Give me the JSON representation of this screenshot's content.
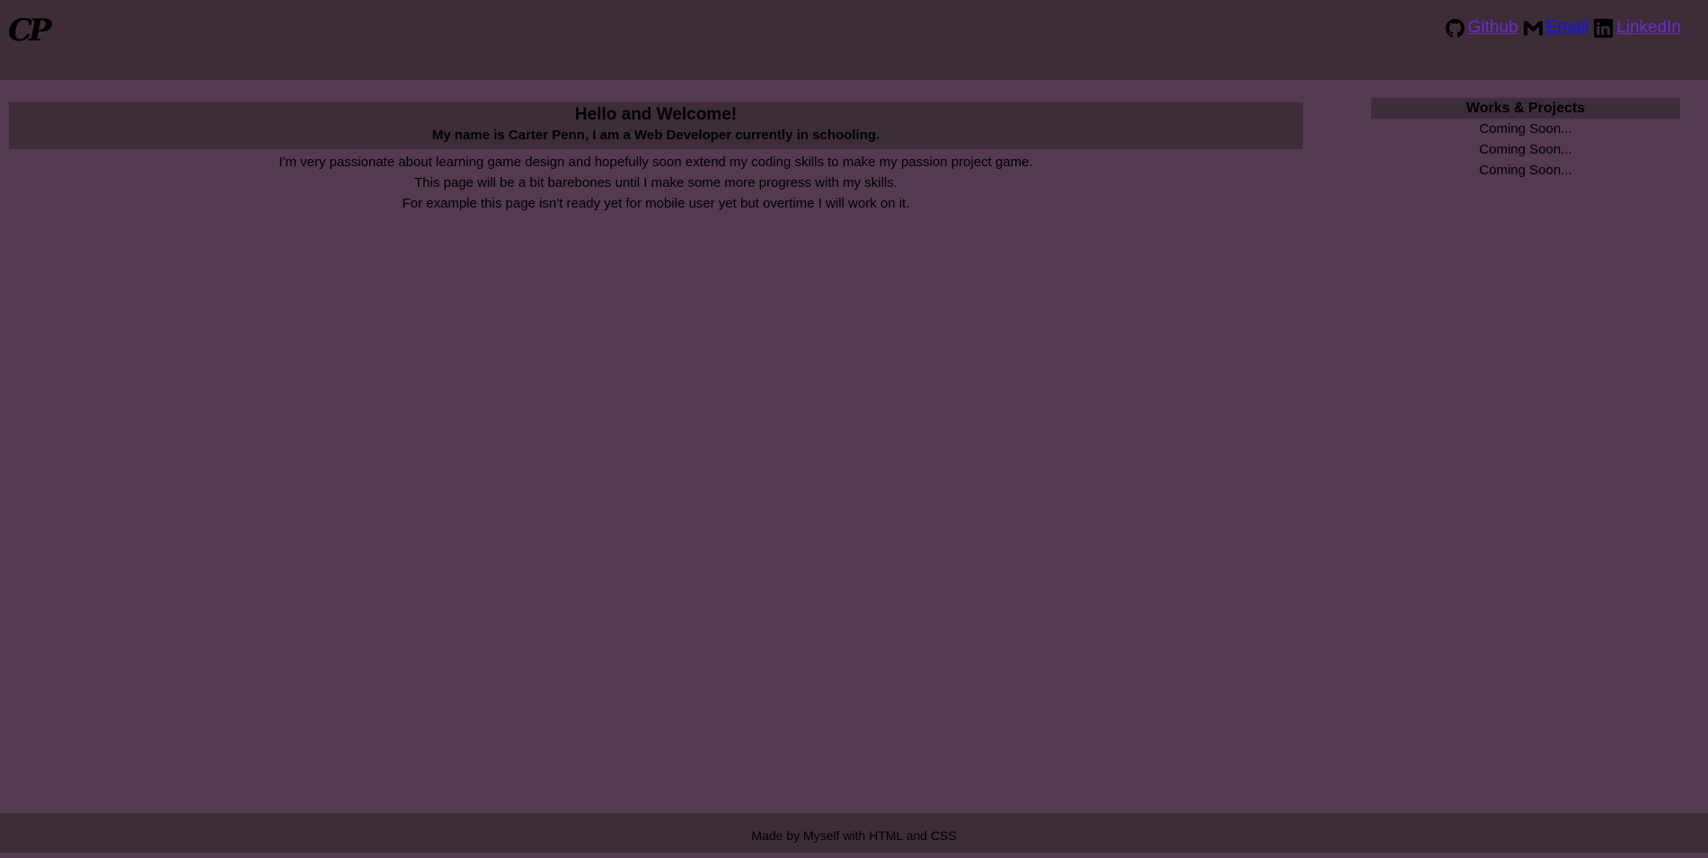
{
  "header": {
    "logo": "CP",
    "links": [
      {
        "icon": "github-icon",
        "label": " Github ",
        "state": "visited"
      },
      {
        "icon": "gmail-icon",
        "label": " Email ",
        "state": "fresh"
      },
      {
        "icon": "linkedin-icon",
        "label": " LinkedIn",
        "state": "visited"
      }
    ]
  },
  "main": {
    "title": "Hello and Welcome!",
    "subtitle": "My name is Carter Penn, I am a Web Developer currently in schooling.",
    "paragraphs": [
      "I'm very passionate about learning game design and hopefully soon extend my coding skills to make my passion project game.",
      "This page will be a bit barebones until I make some more progress with my skills.",
      "For example this page isn't ready yet for mobile user yet but overtime I will work on it."
    ]
  },
  "works": {
    "title": "Works & Projects",
    "items": [
      "Coming Soon...",
      "Coming Soon...",
      "Coming Soon..."
    ]
  },
  "footer": {
    "text": "Made by Myself with HTML and CSS"
  },
  "colors": {
    "background": "#533a4f",
    "panel": "#3c2d38",
    "link_visited": "#6a2ccf",
    "link": "#1010ff"
  }
}
